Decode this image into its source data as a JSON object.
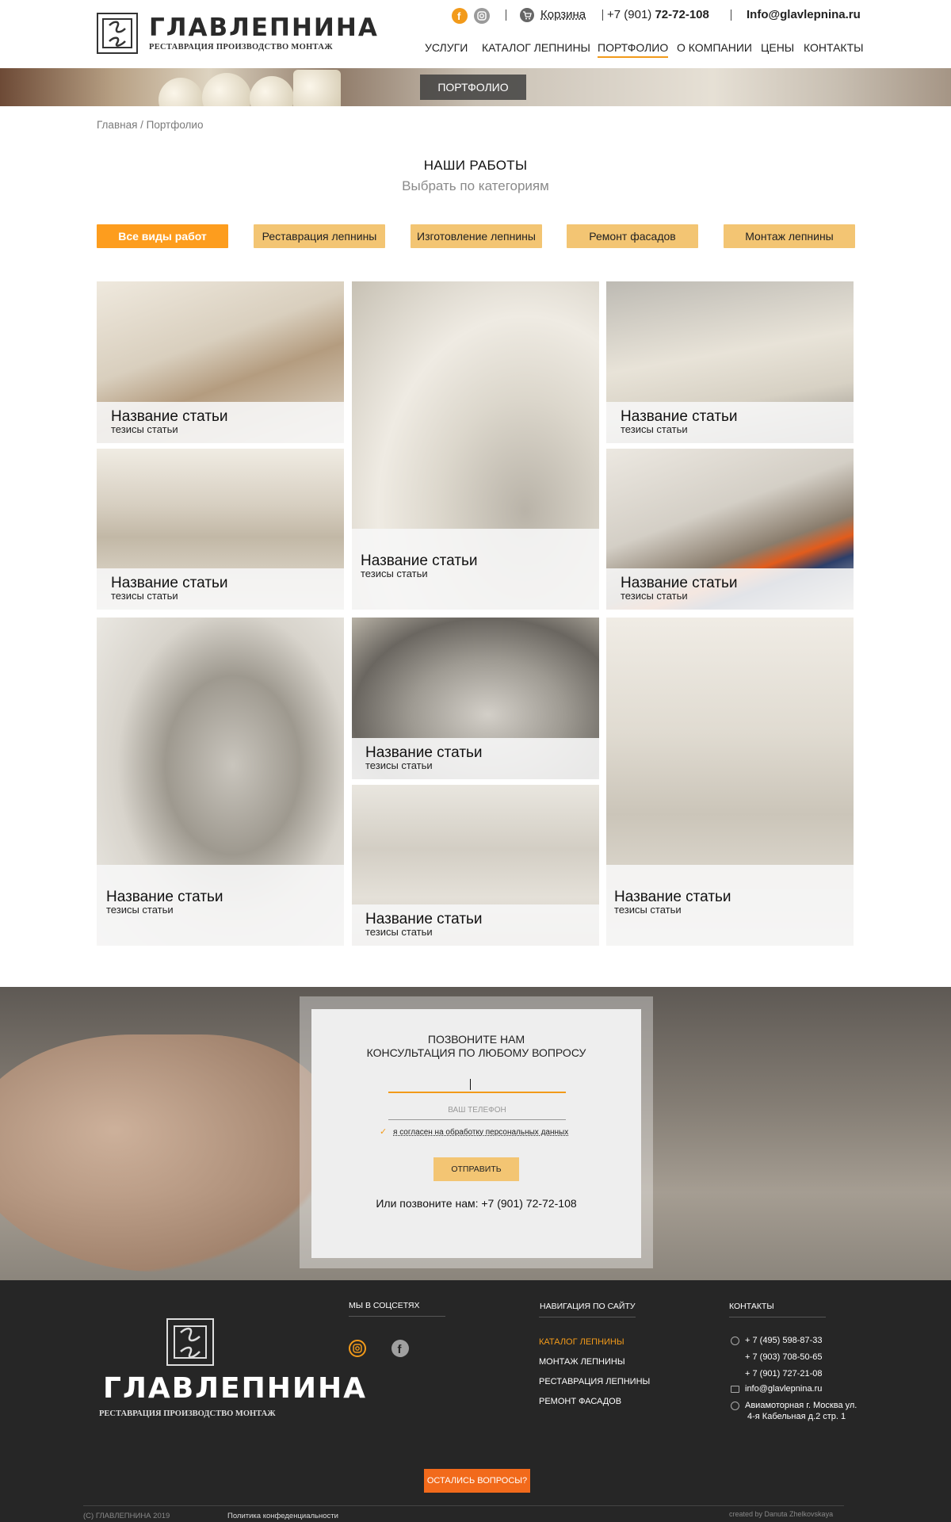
{
  "header": {
    "logo": {
      "name": "ГЛАВЛЕПНИНА",
      "subtitle": "РЕСТАВРАЦИЯ ПРОИЗВОДСТВО МОНТАЖ"
    },
    "cart_label": "Корзина",
    "phone_prefix": "+7 (901) ",
    "phone_number": "72-72-108",
    "email": "Info@glavlepnina.ru",
    "nav": [
      "УСЛУГИ",
      "КАТАЛОГ ЛЕПНИНЫ",
      "ПОРТФОЛИО",
      "О КОМПАНИИ",
      "ЦЕНЫ",
      "КОНТАКТЫ"
    ],
    "nav_active": "ПОРТФОЛИО"
  },
  "banner": {
    "label": "ПОРТФОЛИО"
  },
  "breadcrumb": "Главная / Портфолио",
  "section": {
    "title": "НАШИ РАБОТЫ",
    "subtitle": "Выбрать по категориям"
  },
  "filters": [
    "Все виды работ",
    "Реставрация лепнины",
    "Изготовление лепнины",
    "Ремонт фасадов",
    "Монтаж лепнины"
  ],
  "cards": [
    {
      "title": "Название статьи",
      "subtitle": "тезисы статьи"
    },
    {
      "title": "Название статьи",
      "subtitle": "тезисы статьи"
    },
    {
      "title": "Название статьи",
      "subtitle": "тезисы статьи"
    },
    {
      "title": "Название статьи",
      "subtitle": "тезисы статьи"
    },
    {
      "title": "Название статьи",
      "subtitle": "тезисы статьи"
    },
    {
      "title": "Название статьи",
      "subtitle": "тезисы статьи"
    },
    {
      "title": "Название статьи",
      "subtitle": "тезисы статьи"
    },
    {
      "title": "Название статьи",
      "subtitle": "тезисы статьи"
    },
    {
      "title": "Название статьи",
      "subtitle": "тезисы статьи"
    },
    {
      "title": "Название статьи",
      "subtitle": "тезисы статьи"
    }
  ],
  "callback": {
    "title_line1": "ПОЗВОНИТЕ НАМ",
    "title_line2": "КОНСУЛЬТАЦИЯ ПО ЛЮБОМУ ВОПРОСУ",
    "phone_placeholder": "ВАШ ТЕЛЕФОН",
    "agree": "я согласен на обработку персональных данных",
    "submit": "ОТПРАВИТЬ",
    "call_text": "Или позвоните нам: +7 (901) 72-72-108"
  },
  "footer": {
    "logo": {
      "name": "ГЛАВЛЕПНИНА",
      "subtitle": "РЕСТАВРАЦИЯ ПРОИЗВОДСТВО МОНТАЖ"
    },
    "social_title": "МЫ В СОЦСЕТЯХ",
    "nav_title": "НАВИГАЦИЯ ПО САЙТУ",
    "nav": [
      "КАТАЛОГ ЛЕПНИНЫ",
      "МОНТАЖ ЛЕПНИНЫ",
      "РЕСТАВРАЦИЯ ЛЕПНИНЫ",
      "РЕМОНТ ФАСАДОВ"
    ],
    "contacts_title": "КОНТАКТЫ",
    "phones": [
      "+ 7 (495) 598-87-33",
      "+ 7 (903) 708-50-65",
      "+ 7 (901) 727-21-08"
    ],
    "email": "info@glavlepnina.ru",
    "address_line1": "Авиамоторная г. Москва ул.",
    "address_line2": "4-я Кабельная д.2 стр. 1",
    "ask_button": "ОСТАЛИСЬ ВОПРОСЫ?",
    "copyright": "(С) ГЛАВЛЕПНИНА 2019",
    "policy": "Политика конфеденциальности",
    "credit": "created by Danuta Zhelkovskaya"
  },
  "colors": {
    "accent": "#fd9d1e",
    "filter": "#f3c573",
    "footer_bg": "#262626",
    "cta": "#f26a1b"
  }
}
